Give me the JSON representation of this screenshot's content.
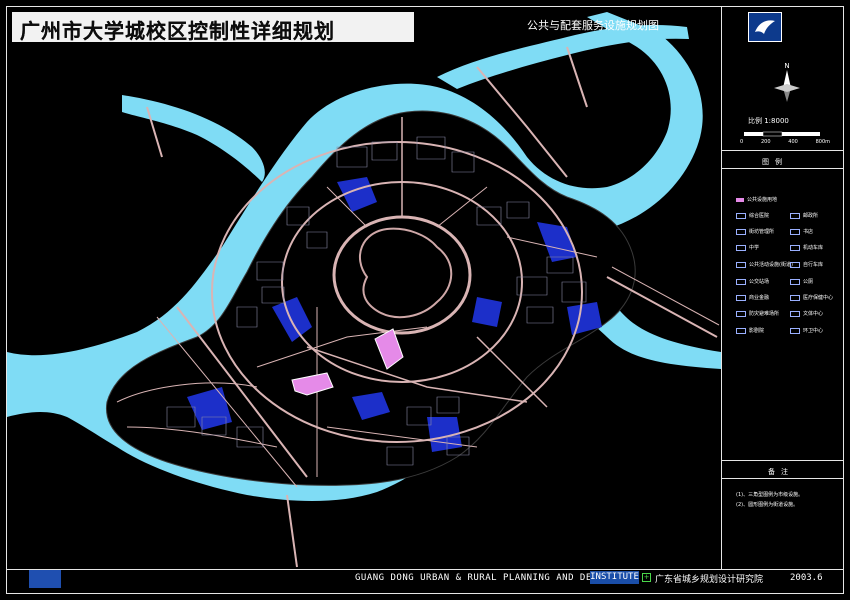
{
  "title": "广州市大学城校区控制性详细规划",
  "subtitle": "公共与配套服务设施规划图",
  "north_label": "N",
  "scale": {
    "label": "比例  1:8000",
    "ticks": [
      "0",
      "200",
      "400",
      "800m"
    ]
  },
  "legend": {
    "title": "图例",
    "highlight_item": "公共设施用地",
    "items_left": [
      "综合医院",
      "街坊管理所",
      "中学",
      "公共活动设施(街道)",
      "公交站场",
      "商业金融",
      "防灾避难场所",
      "影剧院"
    ],
    "items_right": [
      "邮政所",
      "书店",
      "机动车库",
      "自行车库",
      "公厕",
      "医疗保健中心",
      "文体中心",
      "环卫中心"
    ]
  },
  "notes": {
    "title": "备注",
    "lines": [
      "(1)、三角型图例为市级设施。",
      "(2)、圆形图例为街道设施。"
    ]
  },
  "footer": {
    "institute_en": "GUANG DONG URBAN & RURAL PLANNING AND DESIGN",
    "institute_badge": "INSTITUTE",
    "institute_cn": "广东省城乡规划设计研究院",
    "date": "2003.6"
  },
  "colors": {
    "water": "#7fdcf5",
    "island": "#000000",
    "roads": "#d9b4b4",
    "vegetation": "#1c2fc9",
    "public_facility": "#e58ae8"
  }
}
